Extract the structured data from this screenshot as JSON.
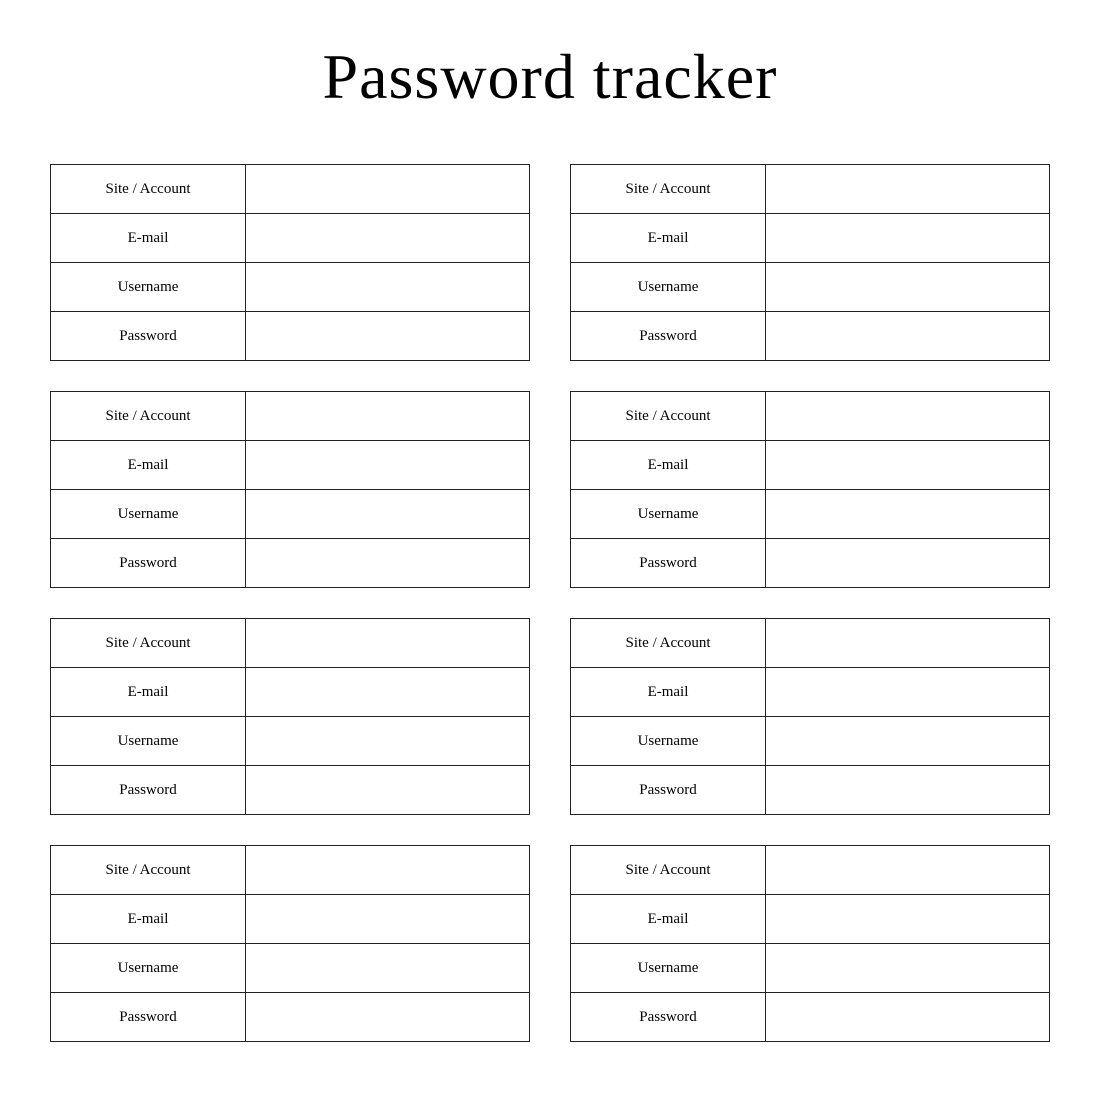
{
  "page": {
    "title": "Password tracker"
  },
  "cards": [
    {
      "id": 1,
      "rows": [
        {
          "label": "Site / Account",
          "value": ""
        },
        {
          "label": "E-mail",
          "value": ""
        },
        {
          "label": "Username",
          "value": ""
        },
        {
          "label": "Password",
          "value": ""
        }
      ]
    },
    {
      "id": 2,
      "rows": [
        {
          "label": "Site / Account",
          "value": ""
        },
        {
          "label": "E-mail",
          "value": ""
        },
        {
          "label": "Username",
          "value": ""
        },
        {
          "label": "Password",
          "value": ""
        }
      ]
    },
    {
      "id": 3,
      "rows": [
        {
          "label": "Site / Account",
          "value": ""
        },
        {
          "label": "E-mail",
          "value": ""
        },
        {
          "label": "Username",
          "value": ""
        },
        {
          "label": "Password",
          "value": ""
        }
      ]
    },
    {
      "id": 4,
      "rows": [
        {
          "label": "Site / Account",
          "value": ""
        },
        {
          "label": "E-mail",
          "value": ""
        },
        {
          "label": "Username",
          "value": ""
        },
        {
          "label": "Password",
          "value": ""
        }
      ]
    },
    {
      "id": 5,
      "rows": [
        {
          "label": "Site / Account",
          "value": ""
        },
        {
          "label": "E-mail",
          "value": ""
        },
        {
          "label": "Username",
          "value": ""
        },
        {
          "label": "Password",
          "value": ""
        }
      ]
    },
    {
      "id": 6,
      "rows": [
        {
          "label": "Site / Account",
          "value": ""
        },
        {
          "label": "E-mail",
          "value": ""
        },
        {
          "label": "Username",
          "value": ""
        },
        {
          "label": "Password",
          "value": ""
        }
      ]
    },
    {
      "id": 7,
      "rows": [
        {
          "label": "Site / Account",
          "value": ""
        },
        {
          "label": "E-mail",
          "value": ""
        },
        {
          "label": "Username",
          "value": ""
        },
        {
          "label": "Password",
          "value": ""
        }
      ]
    },
    {
      "id": 8,
      "rows": [
        {
          "label": "Site / Account",
          "value": ""
        },
        {
          "label": "E-mail",
          "value": ""
        },
        {
          "label": "Username",
          "value": ""
        },
        {
          "label": "Password",
          "value": ""
        }
      ]
    }
  ],
  "row_labels": {
    "site_account": "Site / Account",
    "email": "E-mail",
    "username": "Username",
    "password": "Password"
  }
}
